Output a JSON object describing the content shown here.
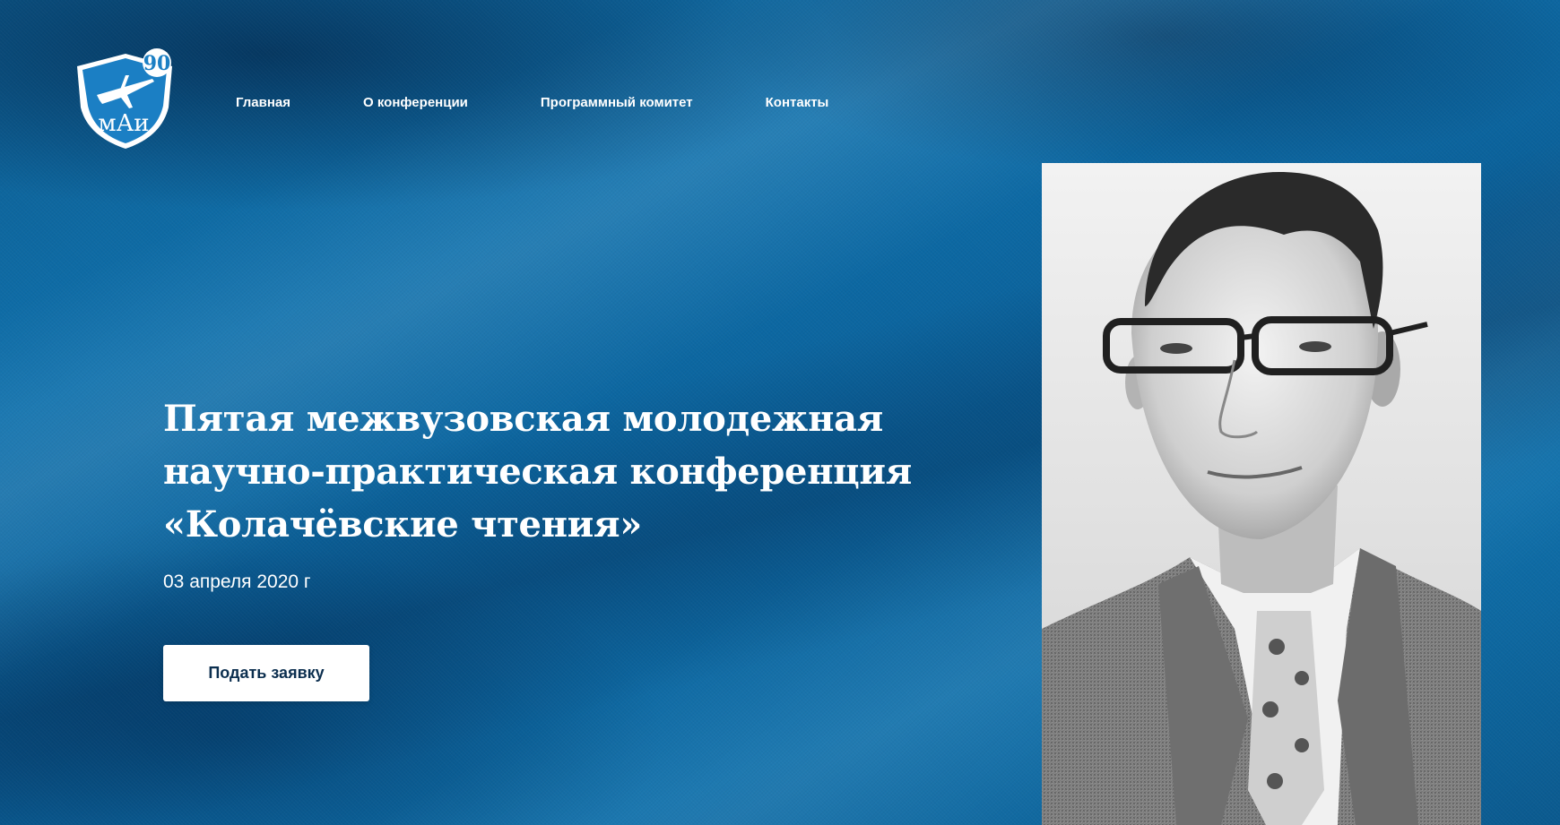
{
  "header": {
    "logo": {
      "text": "мАи",
      "badge": "90",
      "icon": "mai-shield-logo-icon"
    },
    "nav": [
      {
        "label": "Главная"
      },
      {
        "label": "О конференции"
      },
      {
        "label": "Программный комитет"
      },
      {
        "label": "Контакты"
      }
    ]
  },
  "hero": {
    "title_lines": [
      "Пятая межвузовская молодежная",
      "научно-практическая конференция",
      "«Колачёвские чтения»"
    ],
    "date": "03 апреля 2020 г",
    "apply_label": "Подать заявку",
    "portrait": {
      "description_icon": "portrait-photo-icon"
    }
  },
  "colors": {
    "background": "#0f70ab",
    "button_text": "#0c2f4f",
    "button_background": "#ffffff",
    "logo_blue": "#1b7fc4"
  }
}
